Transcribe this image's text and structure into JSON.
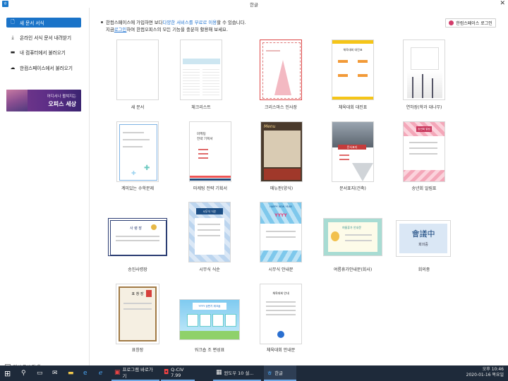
{
  "window": {
    "title": "한글",
    "close": "✕"
  },
  "sidebar": {
    "items": [
      {
        "label": "새 문서 서식",
        "icon": "document-icon"
      },
      {
        "label": "온라인 서식 문서 내려받기",
        "icon": "download-icon"
      },
      {
        "label": "내 컴퓨터에서 불러오기",
        "icon": "folder-icon"
      },
      {
        "label": "한컴스페이스에서 불러오기",
        "icon": "cloud-icon"
      }
    ],
    "banner": {
      "sub": "어디서나 펼쳐지는",
      "main": "오피스 세상"
    },
    "dont_show": "다시 표시 안 함"
  },
  "notice": {
    "line1_pre": "한컴스페이스에 가입하면 보다 ",
    "line1_link": "다양한 서비스를 무료로 이용",
    "line1_post": "할 수 있습니다.",
    "line2_pre": "지금 ",
    "line2_link": "로그인",
    "line2_post": "하여 한컴오피스의 모든 기능을 충분히 활용해 보세요."
  },
  "login_button": "한컴스페이스 로그인",
  "templates": [
    {
      "label": "새 문서"
    },
    {
      "label": "체크리스트"
    },
    {
      "label": "크리스마스 인사장"
    },
    {
      "label": "체육대회 대진표"
    },
    {
      "label": "연하장(학과 대나무)"
    },
    {
      "label": "계미있는 수학문제"
    },
    {
      "label": "마케팅 전략 기획서"
    },
    {
      "label": "메뉴판(양식)"
    },
    {
      "label": "문서표지(건축)"
    },
    {
      "label": "송년회 알림표"
    },
    {
      "label": "승진사령장"
    },
    {
      "label": "시무식 식순"
    },
    {
      "label": "시무식 안내문"
    },
    {
      "label": "여름휴가안내문(회사)"
    },
    {
      "label": "회의중"
    },
    {
      "label": "표창장"
    },
    {
      "label": "워크숍 조 편성표"
    },
    {
      "label": "체육대회 안내문"
    }
  ],
  "thumb_text": {
    "bracket": "체육대회 대진표",
    "marketing": "마케팅\n전략 기획서",
    "menu": "Menu",
    "cover": "문서표지",
    "year_end": "송년회 알림",
    "promotion": "사 령 장",
    "ceremony": "시무식 식순",
    "happy": "HAPPY NEW YEAR",
    "yyyy": "YYYY",
    "vacation": "여름휴가 안내문",
    "meeting": "會議中",
    "meeting_sub": "회의중",
    "award": "표 창 장",
    "workshop": "YYYY 상반기 워크숍",
    "sports": "체육대회 안내"
  },
  "taskbar": {
    "start": "⊞",
    "apps": [
      {
        "label": "프로그램 바로가기",
        "icon": "tv-icon"
      },
      {
        "label": "Q-CIV 7.99",
        "icon": "q-icon"
      },
      {
        "label": "윈도우 10 설...",
        "icon": "window-icon"
      },
      {
        "label": "한글",
        "icon": "hangul-icon"
      }
    ],
    "time": "오후 10:46",
    "date": "2020-01-16 목요일"
  },
  "colors": {
    "accent": "#1a73c8",
    "taskbar": "#1e2a3a"
  }
}
